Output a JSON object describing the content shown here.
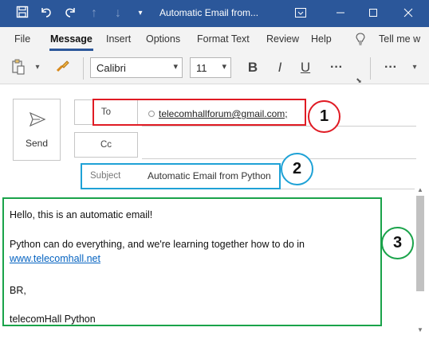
{
  "window": {
    "title": "Automatic Email from...",
    "quick_access": [
      "save-icon",
      "undo-icon",
      "redo-icon",
      "up-arrow-icon",
      "down-arrow-icon",
      "customize-icon"
    ],
    "controls": [
      "ribbon-display-icon",
      "minimize-icon",
      "maximize-icon",
      "close-icon"
    ],
    "accent": "#2b579a"
  },
  "menu": {
    "items": [
      "File",
      "Message",
      "Insert",
      "Options",
      "Format Text",
      "Review",
      "Help"
    ],
    "active": "Message",
    "tell_me": "Tell me w"
  },
  "toolbar": {
    "font_name": "Calibri",
    "font_size": "11",
    "bold": "B",
    "italic": "I",
    "underline": "U",
    "more": "···"
  },
  "compose": {
    "send_label": "Send",
    "to_label": "To",
    "cc_label": "Cc",
    "to_value": "telecomhallforum@gmail.com;",
    "subject_label": "Subject",
    "subject_value": "Automatic Email from Python"
  },
  "body": {
    "greeting": "Hello, this is an automatic email!",
    "line1": "Python can do everything, and we're learning together how to do in",
    "link": "www.telecomhall.net",
    "signoff": "BR,",
    "signature": "telecomHall Python"
  },
  "annotations": {
    "labels": [
      "1",
      "2",
      "3"
    ],
    "colors": [
      "#e01b24",
      "#1fa2d6",
      "#1aa34a"
    ]
  }
}
